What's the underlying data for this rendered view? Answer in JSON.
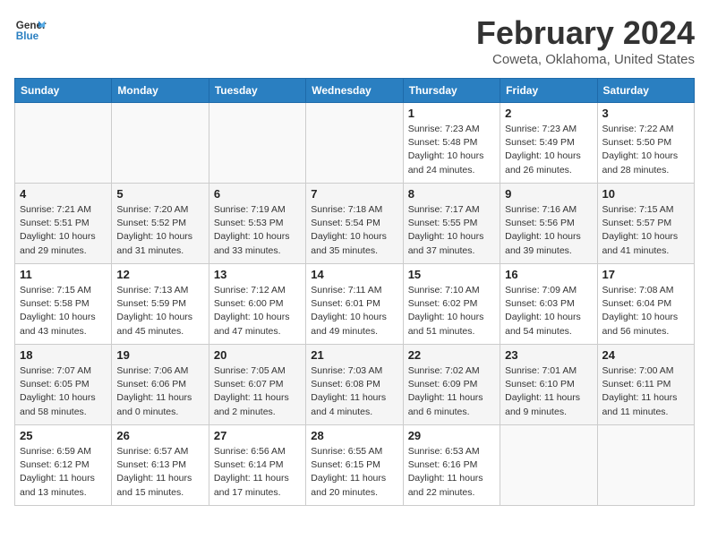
{
  "header": {
    "logo_line1": "General",
    "logo_line2": "Blue",
    "month": "February 2024",
    "location": "Coweta, Oklahoma, United States"
  },
  "weekdays": [
    "Sunday",
    "Monday",
    "Tuesday",
    "Wednesday",
    "Thursday",
    "Friday",
    "Saturday"
  ],
  "weeks": [
    [
      {
        "day": "",
        "detail": ""
      },
      {
        "day": "",
        "detail": ""
      },
      {
        "day": "",
        "detail": ""
      },
      {
        "day": "",
        "detail": ""
      },
      {
        "day": "1",
        "detail": "Sunrise: 7:23 AM\nSunset: 5:48 PM\nDaylight: 10 hours\nand 24 minutes."
      },
      {
        "day": "2",
        "detail": "Sunrise: 7:23 AM\nSunset: 5:49 PM\nDaylight: 10 hours\nand 26 minutes."
      },
      {
        "day": "3",
        "detail": "Sunrise: 7:22 AM\nSunset: 5:50 PM\nDaylight: 10 hours\nand 28 minutes."
      }
    ],
    [
      {
        "day": "4",
        "detail": "Sunrise: 7:21 AM\nSunset: 5:51 PM\nDaylight: 10 hours\nand 29 minutes."
      },
      {
        "day": "5",
        "detail": "Sunrise: 7:20 AM\nSunset: 5:52 PM\nDaylight: 10 hours\nand 31 minutes."
      },
      {
        "day": "6",
        "detail": "Sunrise: 7:19 AM\nSunset: 5:53 PM\nDaylight: 10 hours\nand 33 minutes."
      },
      {
        "day": "7",
        "detail": "Sunrise: 7:18 AM\nSunset: 5:54 PM\nDaylight: 10 hours\nand 35 minutes."
      },
      {
        "day": "8",
        "detail": "Sunrise: 7:17 AM\nSunset: 5:55 PM\nDaylight: 10 hours\nand 37 minutes."
      },
      {
        "day": "9",
        "detail": "Sunrise: 7:16 AM\nSunset: 5:56 PM\nDaylight: 10 hours\nand 39 minutes."
      },
      {
        "day": "10",
        "detail": "Sunrise: 7:15 AM\nSunset: 5:57 PM\nDaylight: 10 hours\nand 41 minutes."
      }
    ],
    [
      {
        "day": "11",
        "detail": "Sunrise: 7:15 AM\nSunset: 5:58 PM\nDaylight: 10 hours\nand 43 minutes."
      },
      {
        "day": "12",
        "detail": "Sunrise: 7:13 AM\nSunset: 5:59 PM\nDaylight: 10 hours\nand 45 minutes."
      },
      {
        "day": "13",
        "detail": "Sunrise: 7:12 AM\nSunset: 6:00 PM\nDaylight: 10 hours\nand 47 minutes."
      },
      {
        "day": "14",
        "detail": "Sunrise: 7:11 AM\nSunset: 6:01 PM\nDaylight: 10 hours\nand 49 minutes."
      },
      {
        "day": "15",
        "detail": "Sunrise: 7:10 AM\nSunset: 6:02 PM\nDaylight: 10 hours\nand 51 minutes."
      },
      {
        "day": "16",
        "detail": "Sunrise: 7:09 AM\nSunset: 6:03 PM\nDaylight: 10 hours\nand 54 minutes."
      },
      {
        "day": "17",
        "detail": "Sunrise: 7:08 AM\nSunset: 6:04 PM\nDaylight: 10 hours\nand 56 minutes."
      }
    ],
    [
      {
        "day": "18",
        "detail": "Sunrise: 7:07 AM\nSunset: 6:05 PM\nDaylight: 10 hours\nand 58 minutes."
      },
      {
        "day": "19",
        "detail": "Sunrise: 7:06 AM\nSunset: 6:06 PM\nDaylight: 11 hours\nand 0 minutes."
      },
      {
        "day": "20",
        "detail": "Sunrise: 7:05 AM\nSunset: 6:07 PM\nDaylight: 11 hours\nand 2 minutes."
      },
      {
        "day": "21",
        "detail": "Sunrise: 7:03 AM\nSunset: 6:08 PM\nDaylight: 11 hours\nand 4 minutes."
      },
      {
        "day": "22",
        "detail": "Sunrise: 7:02 AM\nSunset: 6:09 PM\nDaylight: 11 hours\nand 6 minutes."
      },
      {
        "day": "23",
        "detail": "Sunrise: 7:01 AM\nSunset: 6:10 PM\nDaylight: 11 hours\nand 9 minutes."
      },
      {
        "day": "24",
        "detail": "Sunrise: 7:00 AM\nSunset: 6:11 PM\nDaylight: 11 hours\nand 11 minutes."
      }
    ],
    [
      {
        "day": "25",
        "detail": "Sunrise: 6:59 AM\nSunset: 6:12 PM\nDaylight: 11 hours\nand 13 minutes."
      },
      {
        "day": "26",
        "detail": "Sunrise: 6:57 AM\nSunset: 6:13 PM\nDaylight: 11 hours\nand 15 minutes."
      },
      {
        "day": "27",
        "detail": "Sunrise: 6:56 AM\nSunset: 6:14 PM\nDaylight: 11 hours\nand 17 minutes."
      },
      {
        "day": "28",
        "detail": "Sunrise: 6:55 AM\nSunset: 6:15 PM\nDaylight: 11 hours\nand 20 minutes."
      },
      {
        "day": "29",
        "detail": "Sunrise: 6:53 AM\nSunset: 6:16 PM\nDaylight: 11 hours\nand 22 minutes."
      },
      {
        "day": "",
        "detail": ""
      },
      {
        "day": "",
        "detail": ""
      }
    ]
  ]
}
